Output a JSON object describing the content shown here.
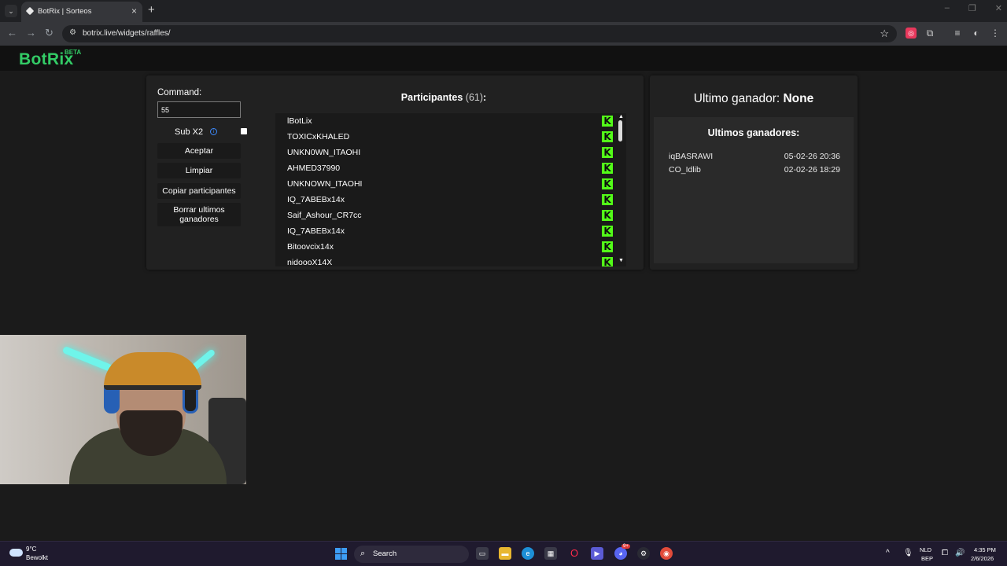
{
  "browser": {
    "tab_title": "BotRix | Sorteos",
    "tab_list_icon": "chevron-down-icon",
    "new_tab_label": "+",
    "url": "botrix.live/widgets/raffles/",
    "window_controls": [
      "–",
      "❐",
      "✕"
    ]
  },
  "app": {
    "logo": "BotRix",
    "beta": "BETA",
    "brand_color": "#33cc66"
  },
  "raffle": {
    "command_label": "Command:",
    "command_value": "55",
    "sub_label": "Sub X2",
    "sub_checked": false,
    "buttons": {
      "accept": "Aceptar",
      "clear": "Limpiar",
      "copy": "Copiar participantes",
      "delete_winners": "Borrar ultimos ganadores"
    },
    "participants_title": "Participantes",
    "participants_count": "(61)",
    "participants_suffix": ":",
    "participants": [
      "lBotLix",
      "TOXICxKHALED",
      "UNKN0WN_ITAOHI",
      "AHMED37990",
      "UNKNOWN_ITAOHI",
      "IQ_7ABEBx14x",
      "Saif_Ashour_CR7cc",
      "IQ_7ABEBx14x",
      "Bitoovcix14x",
      "nidoooX14X"
    ],
    "platform_icon": "kick-icon",
    "platform_color": "#53fc18"
  },
  "winners": {
    "last_winner_label": "Ultimo ganador:",
    "last_winner_value": "None",
    "list_title": "Ultimos ganadores:",
    "list": [
      {
        "name": "iqBASRAWI",
        "date": "05-02-26 20:36"
      },
      {
        "name": "CO_Idlib",
        "date": "02-02-26 18:29"
      }
    ]
  },
  "taskbar": {
    "weather_temp": "9°C",
    "weather_desc": "Bewolkt",
    "search_placeholder": "Search",
    "language": "NLD",
    "layout": "BEP",
    "time": "4:35 PM",
    "date": "2/6/2026",
    "badge": "9+"
  }
}
